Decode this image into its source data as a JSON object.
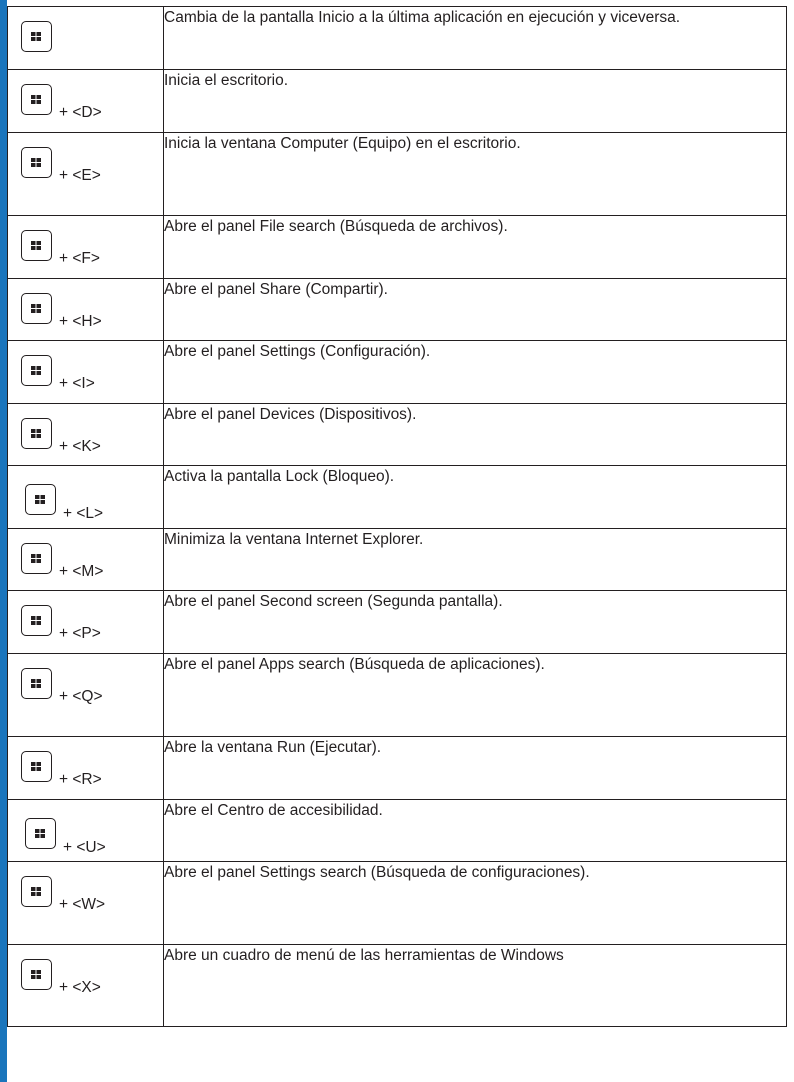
{
  "shortcuts": [
    {
      "keys": "",
      "description": "Cambia de la pantalla Inicio a la última aplicación en ejecución y viceversa."
    },
    {
      "keys": "+ <D>",
      "description": "Inicia el escritorio."
    },
    {
      "keys": "+ <E>",
      "description": "Inicia la ventana Computer (Equipo) en el escritorio."
    },
    {
      "keys": "+ <F>",
      "description": "Abre el panel File search (Búsqueda de archivos)."
    },
    {
      "keys": "+ <H>",
      "description": "Abre el panel Share (Compartir)."
    },
    {
      "keys": "+ <I>",
      "description": "Abre el panel Settings (Configuración)."
    },
    {
      "keys": "+ <K>",
      "description": "Abre el panel Devices (Dispositivos)."
    },
    {
      "keys": "+ <L>",
      "description": "Activa la pantalla Lock (Bloqueo)."
    },
    {
      "keys": "+ <M>",
      "description": "Minimiza la ventana Internet Explorer."
    },
    {
      "keys": "+ <P>",
      "description": "Abre el panel Second screen (Segunda pantalla)."
    },
    {
      "keys": "+ <Q>",
      "description": "Abre el panel Apps search (Búsqueda de aplicaciones)."
    },
    {
      "keys": "+ <R>",
      "description": "Abre la ventana Run (Ejecutar)."
    },
    {
      "keys": "+ <U>",
      "description": "Abre el Centro de accesibilidad."
    },
    {
      "keys": "+ <W>",
      "description": "Abre el panel Settings search (Búsqueda de configuraciones)."
    },
    {
      "keys": "+ <X>",
      "description": "Abre un cuadro de menú de las herramientas de Windows"
    }
  ],
  "icons": {
    "windows_key": "windows-logo-icon"
  },
  "colors": {
    "accent_bar": "#1a75bc",
    "text": "#231f20"
  }
}
